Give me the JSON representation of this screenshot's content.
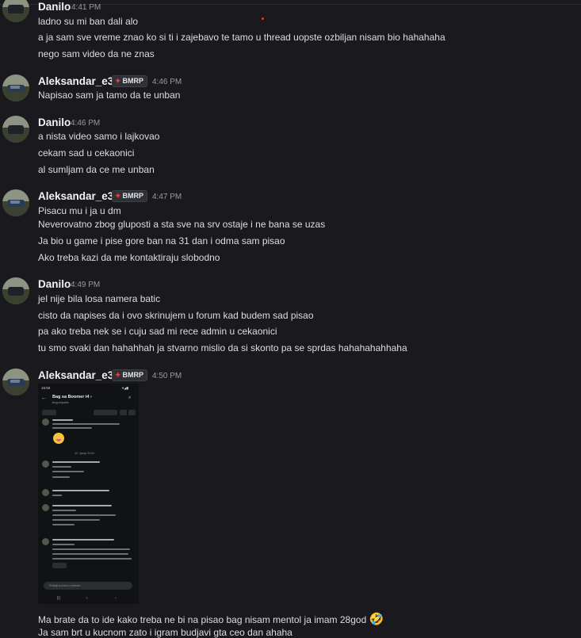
{
  "messages": [
    {
      "user": "Danilo",
      "time": "4:41 PM",
      "badge": null,
      "lines": [
        "ladno su mi ban dali alo",
        "a ja sam sve vreme znao ko si ti i zajebavo te tamo u thread uopste ozbiljan nisam bio hahahaha",
        "nego sam video da ne znas"
      ]
    },
    {
      "user": "Aleksandar_e36",
      "time": "4:46 PM",
      "badge": "BMRP",
      "lines": [
        "Napisao sam ja tamo da te unban"
      ]
    },
    {
      "user": "Danilo",
      "time": "4:46 PM",
      "badge": null,
      "lines": [
        "a nista video samo i lajkovao",
        "cekam sad u cekaonici",
        "al sumljam da ce me unban"
      ]
    },
    {
      "user": "Aleksandar_e36",
      "time": "4:47 PM",
      "badge": "BMRP",
      "lines": [
        "Pisacu mu i ja u dm",
        "Neverovatno zbog gluposti a sta sve na srv ostaje i ne bana se uzas",
        "Ja bio u game i pise gore ban na 31 dan i odma sam pisao",
        "Ako treba kazi da me kontaktiraju slobodno"
      ]
    },
    {
      "user": "Danilo",
      "time": "4:49 PM",
      "badge": null,
      "lines": [
        "jel nije bila losa namera batic",
        "cisto da napises da i ovo skrinujem u forum kad budem sad pisao",
        "pa ako treba nek se i cuju sad mi rece admin u cekaonici",
        "tu smo svaki dan hahahhah ja stvarno mislio da si skonto pa se sprdas hahahahahhaha"
      ]
    },
    {
      "user": "Aleksandar_e36",
      "time": "4:50 PM",
      "badge": "BMRP",
      "lines": [
        "Ma brate da to ide kako treba ne bi na pisao bag nisam mentol ja imam 28god",
        "Ja sam brt u kucnom zato i igram budjavi gta ceo dan ahaha"
      ],
      "emoji": "🤣"
    }
  ],
  "attachment": {
    "status_time": "16:50",
    "status_icons": "▾◢▮",
    "title": "Bag sa Boomer i4 ›",
    "subtitle": "bug-reports",
    "date_divider": "10. lipnja 2024.",
    "input_placeholder": "Pošalji poruku u kanalu ‘…",
    "nav": [
      "|||",
      "○",
      "‹"
    ]
  }
}
